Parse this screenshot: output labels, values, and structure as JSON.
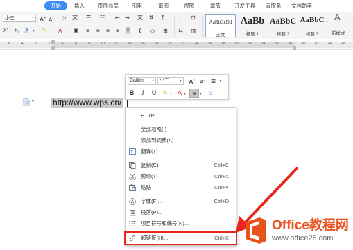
{
  "tabs": [
    "开始",
    "插入",
    "页面布局",
    "引用",
    "审阅",
    "视图",
    "章节",
    "开发工具",
    "云服务",
    "文档助手"
  ],
  "ribbon": {
    "font_size": "小三",
    "styles": [
      {
        "preview": "AaBbCcDd",
        "name": "正文"
      },
      {
        "preview": "AaBb",
        "name": "标题 1"
      },
      {
        "preview": "AaBbC",
        "name": "标题 2"
      },
      {
        "preview": "AaBbC",
        "name": "标题 3"
      }
    ],
    "new_style": "新样式"
  },
  "ruler": {
    "numbers": [
      "6",
      "4",
      "2",
      "2",
      "4",
      "6",
      "8",
      "10",
      "12",
      "14",
      "16",
      "18",
      "20",
      "22",
      "24",
      "26",
      "28",
      "30",
      "32",
      "34",
      "36",
      "38",
      "40",
      "42",
      "44",
      "46"
    ]
  },
  "document": {
    "url_text": "http://www.wps.cn/"
  },
  "mini_toolbar": {
    "font_name": "Calibri",
    "font_size": "小三",
    "grow_font": "A",
    "shrink_font": "A",
    "bold": "B",
    "italic": "I",
    "underline": "U",
    "font_color": "A"
  },
  "context_menu": {
    "items": [
      {
        "label": "HTTP",
        "shortcut": "",
        "icon": ""
      },
      {
        "label": "全部忽略(I)",
        "shortcut": "",
        "icon": ""
      },
      {
        "label": "添加到词典(A)",
        "shortcut": "",
        "icon": ""
      },
      {
        "label": "翻译(T)",
        "shortcut": "",
        "icon": "translate-icon"
      },
      {
        "label": "复制(C)",
        "shortcut": "Ctrl+C",
        "icon": "copy-icon"
      },
      {
        "label": "剪切(T)",
        "shortcut": "Ctrl+X",
        "icon": "cut-icon"
      },
      {
        "label": "粘贴",
        "shortcut": "Ctrl+V",
        "icon": "paste-icon"
      },
      {
        "label": "字体(F)...",
        "shortcut": "Ctrl+D",
        "icon": "font-icon"
      },
      {
        "label": "段落(P)...",
        "shortcut": "",
        "icon": "paragraph-icon"
      },
      {
        "label": "项目符号和编号(N)...",
        "shortcut": "",
        "icon": "list-icon"
      },
      {
        "label": "超链接(H)...",
        "shortcut": "Ctrl+K",
        "icon": "hyperlink-icon"
      }
    ]
  },
  "watermark": {
    "title": "Office教程网",
    "url": "www.office26.com"
  },
  "colors": {
    "accent": "#3c8cf2",
    "highlight": "#e8261c",
    "watermark": "#e8521c",
    "selection": "#c9c9c9"
  }
}
